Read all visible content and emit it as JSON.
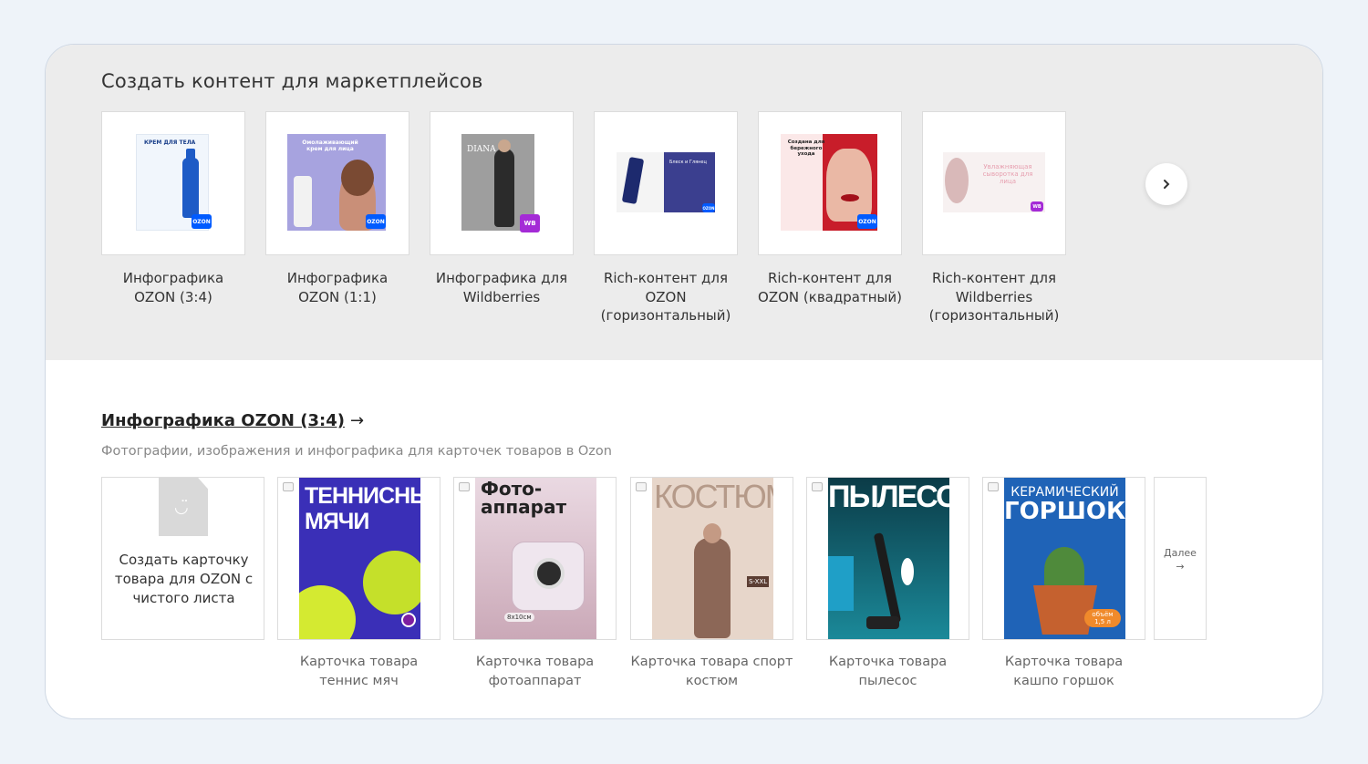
{
  "categories_section": {
    "title": "Создать контент для маркетплейсов",
    "items": [
      {
        "label": "Инфографика OZON (3:4)",
        "thumb_text": "КРЕМ ДЛЯ ТЕЛА",
        "badge": "OZON"
      },
      {
        "label": "Инфографика OZON (1:1)",
        "thumb_text": "Омолаживающий крем для лица",
        "badge": "OZON"
      },
      {
        "label": "Инфографика для Wildberries",
        "thumb_text": "DIANA",
        "badge": "WB"
      },
      {
        "label": "Rich-контент для OZON (горизонтальный)",
        "thumb_text": "Блеск и Глянец",
        "badge": "OZON"
      },
      {
        "label": "Rich-контент для OZON (квадратный)",
        "thumb_text": "Создана для бережного ухода",
        "badge": "OZON"
      },
      {
        "label": "Rich-контент для Wildberries (горизонтальный)",
        "thumb_text": "Увлажняющая сыворотка для лица",
        "badge": "WB"
      }
    ],
    "next_icon": "chevron-right-icon"
  },
  "templates_section": {
    "title": "Инфографика OZON (3:4)",
    "title_arrow": "→",
    "subtitle": "Фотографии, изображения и инфографика для карточек товаров в Ozon",
    "blank_card": {
      "label": "Создать карточку товара для OZON с чистого листа"
    },
    "cards": [
      {
        "label": "Карточка товара теннис мяч",
        "poster_text": "ТЕННИСНЫЕ МЯЧИ"
      },
      {
        "label": "Карточка товара фотоаппарат",
        "poster_text": "Фото-аппарат",
        "poster_sub": "8x10см"
      },
      {
        "label": "Карточка товара спорт костюм",
        "poster_text": "КОСТЮМ",
        "poster_sub": "S-XXL"
      },
      {
        "label": "Карточка товара пылесос",
        "poster_text": "ПЫЛЕСОС"
      },
      {
        "label": "Карточка товара кашпо горшок",
        "poster_text": "КЕРАМИЧЕСКИЙ",
        "poster_text2": "ГОРШОК",
        "poster_sub": "объём 1,5 л"
      }
    ],
    "more_label": "Далее",
    "more_arrow": "→"
  },
  "colors": {
    "ozon_blue": "#005bff",
    "ozon_pink": "#f91155",
    "wb_purple": "#a42bd6",
    "top_band": "#ececec"
  }
}
